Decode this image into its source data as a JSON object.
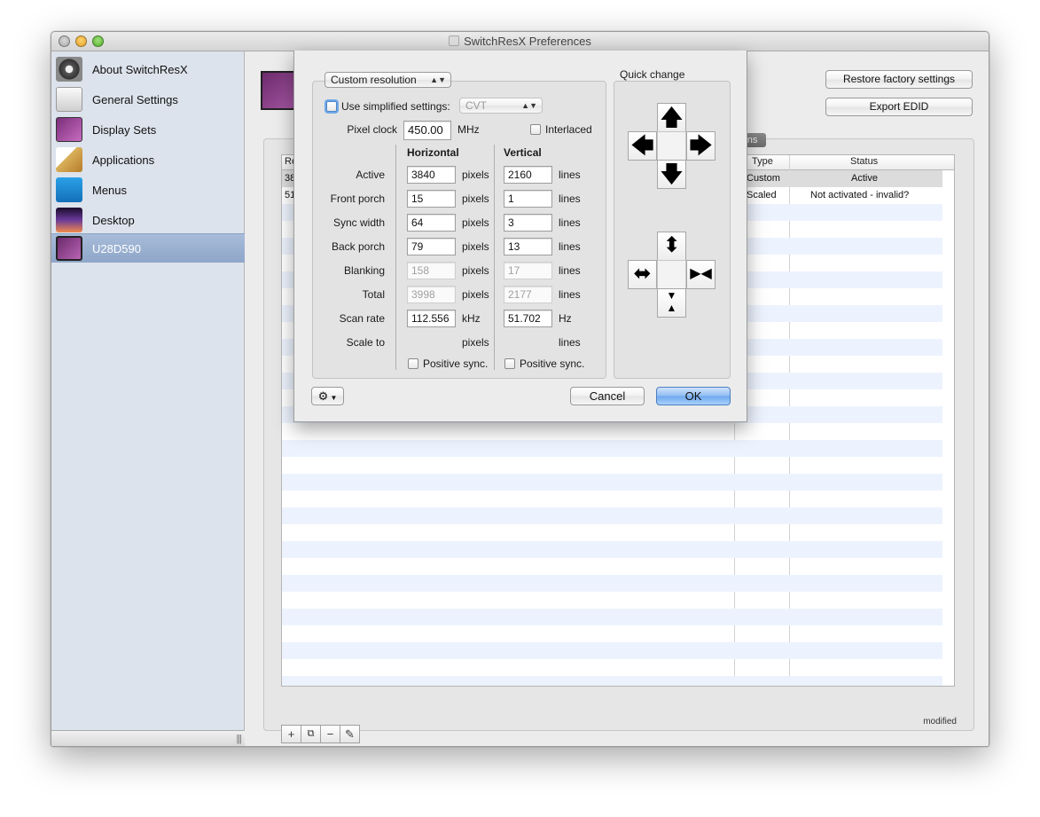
{
  "window": {
    "title": "SwitchResX Preferences"
  },
  "sidebar": {
    "items": [
      {
        "label": "About SwitchResX",
        "icon": "gear-icon"
      },
      {
        "label": "General Settings",
        "icon": "switch-icon"
      },
      {
        "label": "Display Sets",
        "icon": "display-sets-icon"
      },
      {
        "label": "Applications",
        "icon": "applications-icon"
      },
      {
        "label": "Menus",
        "icon": "menus-icon"
      },
      {
        "label": "Desktop",
        "icon": "desktop-icon"
      },
      {
        "label": "U28D590",
        "icon": "monitor-icon",
        "selected": true
      }
    ]
  },
  "main": {
    "restore_label": "Restore factory settings",
    "export_label": "Export EDID",
    "tab_visible": "utions",
    "table": {
      "headers": {
        "resolution": "Re",
        "type": "Type",
        "status": "Status"
      },
      "rows": [
        {
          "resolution": "38",
          "type": "Custom",
          "status": "Active"
        },
        {
          "resolution": "51",
          "type": "Scaled",
          "status": "Not activated - invalid?"
        }
      ]
    },
    "bottom_buttons": [
      "+",
      "duplicate",
      "−",
      "edit"
    ],
    "modified_label": "modified"
  },
  "sheet": {
    "mode_popup": "Custom resolution",
    "simplified_label": "Use simplified settings:",
    "simplified_popup": "CVT",
    "pixel_clock_label": "Pixel clock",
    "pixel_clock_value": "450.00",
    "pixel_clock_unit": "MHz",
    "interlaced_label": "Interlaced",
    "horizontal_header": "Horizontal",
    "vertical_header": "Vertical",
    "quick_change_label": "Quick change",
    "rows": [
      {
        "label": "Active",
        "h": "3840",
        "h_unit": "pixels",
        "v": "2160",
        "v_unit": "lines"
      },
      {
        "label": "Front porch",
        "h": "15",
        "h_unit": "pixels",
        "v": "1",
        "v_unit": "lines"
      },
      {
        "label": "Sync width",
        "h": "64",
        "h_unit": "pixels",
        "v": "3",
        "v_unit": "lines"
      },
      {
        "label": "Back porch",
        "h": "79",
        "h_unit": "pixels",
        "v": "13",
        "v_unit": "lines"
      },
      {
        "label": "Blanking",
        "h": "158",
        "h_unit": "pixels",
        "v": "17",
        "v_unit": "lines"
      },
      {
        "label": "Total",
        "h": "3998",
        "h_unit": "pixels",
        "v": "2177",
        "v_unit": "lines"
      },
      {
        "label": "Scan rate",
        "h": "112.556",
        "h_unit": "kHz",
        "v": "51.702",
        "v_unit": "Hz"
      },
      {
        "label": "Scale to",
        "h": "",
        "h_unit": "pixels",
        "v": "",
        "v_unit": "lines"
      }
    ],
    "h_positive_sync_label": "Positive sync.",
    "v_positive_sync_label": "Positive sync.",
    "cancel_label": "Cancel",
    "ok_label": "OK"
  }
}
